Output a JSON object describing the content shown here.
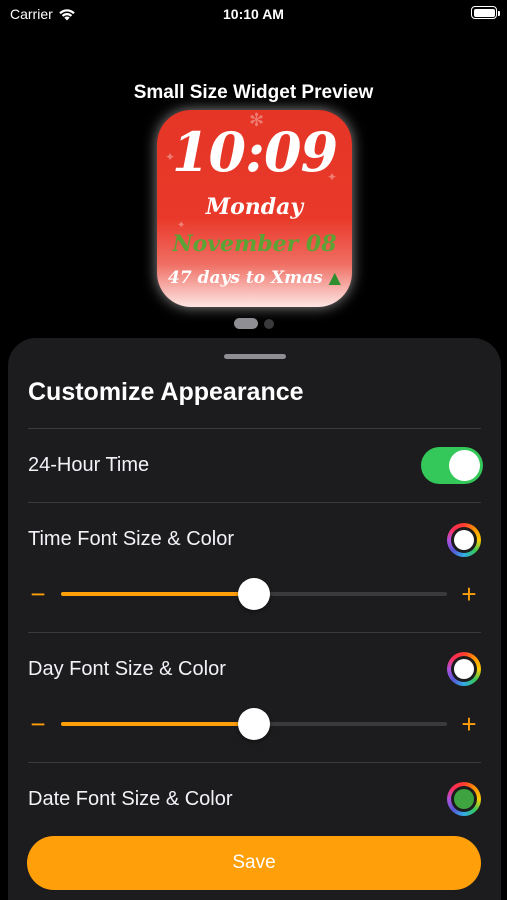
{
  "status_bar": {
    "carrier": "Carrier",
    "time": "10:10 AM"
  },
  "preview": {
    "title": "Small Size Widget Preview",
    "widget": {
      "time": "10:09",
      "day": "Monday",
      "date": "November 08",
      "countdown": "47 days to Xmas",
      "countdown_icon": "christmas-tree-icon",
      "date_color": "#5aa436",
      "background_color": "#e53526"
    },
    "page_count": 2,
    "current_page": 1
  },
  "sheet": {
    "title": "Customize Appearance",
    "hour24": {
      "label": "24-Hour Time",
      "on": true
    },
    "time_font": {
      "label": "Time Font Size & Color",
      "value_fraction": 0.5,
      "swatch_color": "#ffffff"
    },
    "day_font": {
      "label": "Day Font Size & Color",
      "value_fraction": 0.5,
      "swatch_color": "#ffffff"
    },
    "date_font": {
      "label": "Date Font Size & Color",
      "swatch_color": "#3fa33f"
    },
    "minus_symbol": "−",
    "plus_symbol": "+"
  },
  "save_button": {
    "label": "Save",
    "color": "#ff9f0a"
  },
  "colors": {
    "accent": "#ff9f0a",
    "toggle_on": "#34c759",
    "sheet_bg": "#1c1c1e"
  }
}
